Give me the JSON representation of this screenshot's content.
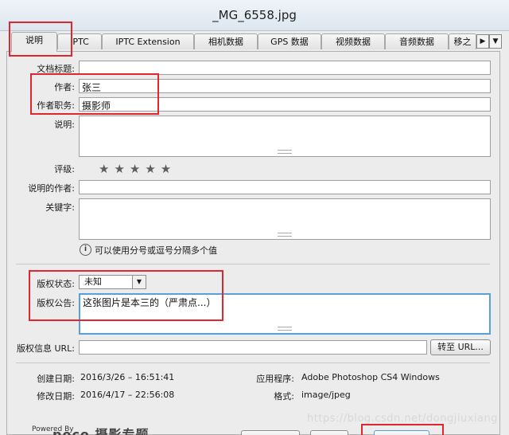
{
  "window": {
    "title": "_MG_6558.jpg"
  },
  "tabs": [
    {
      "label": "说明"
    },
    {
      "label": "IPTC"
    },
    {
      "label": "IPTC Extension"
    },
    {
      "label": "相机数据"
    },
    {
      "label": "GPS 数据"
    },
    {
      "label": "视频数据"
    },
    {
      "label": "音频数据"
    },
    {
      "label": "移之"
    }
  ],
  "tab_scroll": {
    "arrow": "▶",
    "menu": "▼"
  },
  "form": {
    "doc_title": {
      "label": "文档标题:",
      "value": ""
    },
    "author": {
      "label": "作者:",
      "value": "张三"
    },
    "author_title": {
      "label": "作者职务:",
      "value": "摄影师"
    },
    "description": {
      "label": "说明:",
      "value": ""
    },
    "rating": {
      "label": "评级:",
      "stars": 5,
      "value": 0,
      "glyphs": "★★★★★"
    },
    "desc_writer": {
      "label": "说明的作者:",
      "value": ""
    },
    "keywords": {
      "label": "关键字:",
      "value": "",
      "hint": "可以使用分号或逗号分隔多个值",
      "hint_icon": "info-icon"
    },
    "copyright_status": {
      "label": "版权状态:",
      "value": "未知",
      "arrow": "▼"
    },
    "copyright_notice": {
      "label": "版权公告:",
      "value": "这张图片是本三的（严肃点...）"
    },
    "copyright_url": {
      "label": "版权信息 URL:",
      "value": "",
      "button": "转至 URL..."
    }
  },
  "meta": {
    "created": {
      "label": "创建日期:",
      "value": "2016/3/26 – 16:51:41"
    },
    "modified": {
      "label": "修改日期:",
      "value": "2016/4/17 – 22:56:08"
    },
    "app": {
      "label": "应用程序:",
      "value": "Adobe Photoshop CS4 Windows"
    },
    "format": {
      "label": "格式:",
      "value": "image/jpeg"
    }
  },
  "footer": {
    "powered": "Powered By",
    "brand": "poco 摄影专题",
    "watermark": "https://blog.csdn.net/dongjiuxiang"
  },
  "colors": {
    "highlight": "#e0262e",
    "focus": "#5aa0d8"
  }
}
